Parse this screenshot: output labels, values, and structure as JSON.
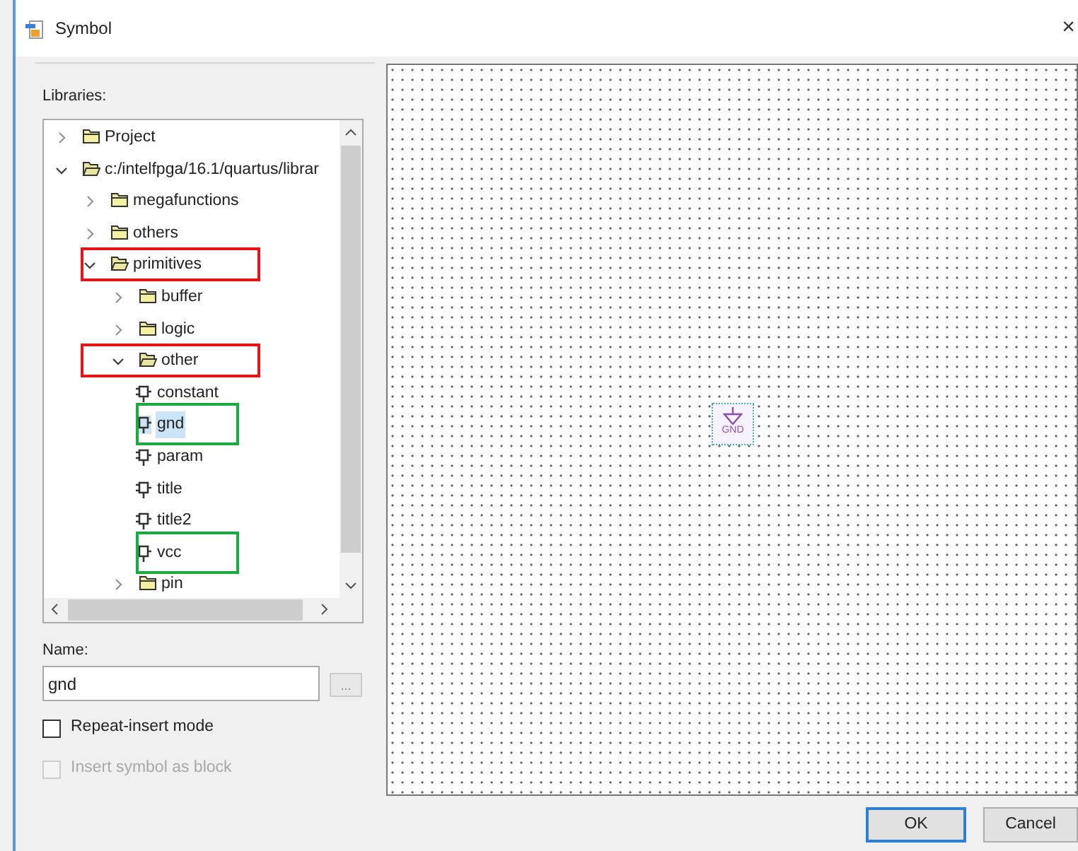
{
  "window": {
    "title": "Symbol",
    "close": "×"
  },
  "libraries": {
    "label": "Libraries:",
    "tree": [
      {
        "kind": "folder",
        "label": "Project",
        "expanded": false,
        "selected": false
      },
      {
        "kind": "folder",
        "label": "c:/intelfpga/16.1/quartus/librar",
        "expanded": true,
        "selected": false,
        "children": [
          {
            "kind": "folder",
            "label": "megafunctions",
            "expanded": false,
            "selected": false
          },
          {
            "kind": "folder",
            "label": "others",
            "expanded": false,
            "selected": false
          },
          {
            "kind": "folder",
            "label": "primitives",
            "expanded": true,
            "selected": false,
            "color": "#e81416",
            "children": [
              {
                "kind": "folder",
                "label": "buffer",
                "expanded": false,
                "selected": false
              },
              {
                "kind": "folder",
                "label": "logic",
                "expanded": false,
                "selected": false
              },
              {
                "kind": "folder",
                "label": "other",
                "expanded": true,
                "selected": false,
                "color": "#e81416",
                "children": [
                  {
                    "kind": "symbol",
                    "label": "constant",
                    "selected": false
                  },
                  {
                    "kind": "symbol",
                    "label": "gnd",
                    "selected": true,
                    "color": "#1aab40"
                  },
                  {
                    "kind": "symbol",
                    "label": "param",
                    "selected": false
                  },
                  {
                    "kind": "symbol",
                    "label": "title",
                    "selected": false
                  },
                  {
                    "kind": "symbol",
                    "label": "title2",
                    "selected": false
                  },
                  {
                    "kind": "symbol",
                    "label": "vcc",
                    "selected": false,
                    "color": "#1aab40"
                  }
                ]
              },
              {
                "kind": "folder",
                "label": "pin",
                "expanded": false,
                "selected": false
              }
            ]
          }
        ]
      }
    ]
  },
  "name": {
    "label": "Name:",
    "value": "gnd",
    "browse": "..."
  },
  "options": [
    {
      "label": "Repeat-insert mode",
      "checked": false,
      "disabled": false
    },
    {
      "label": "Insert symbol as block",
      "checked": false,
      "disabled": true
    }
  ],
  "preview": {
    "symbol_label": "GND"
  },
  "buttons": [
    {
      "label": "OK",
      "default": true
    },
    {
      "label": "Cancel",
      "default": false
    }
  ]
}
